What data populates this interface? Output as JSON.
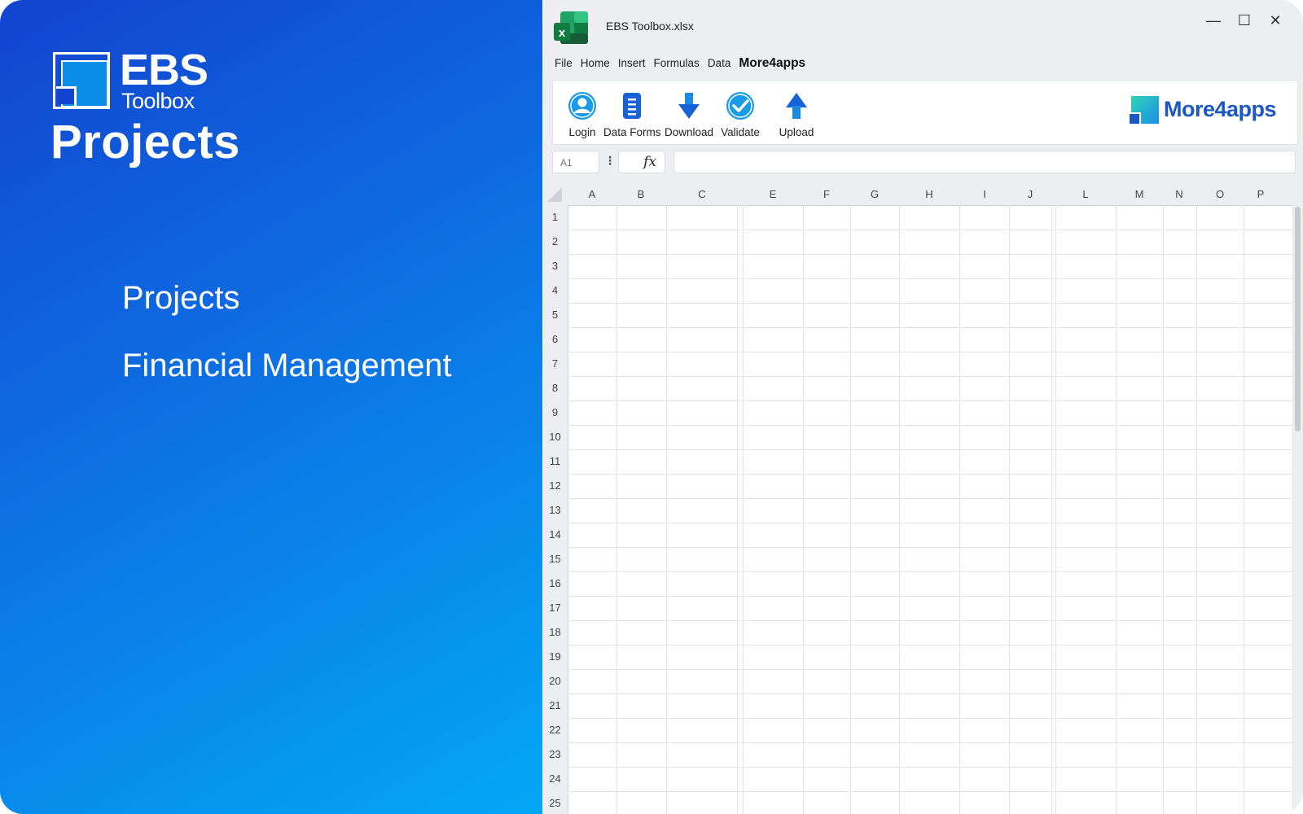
{
  "promo": {
    "brand_name": "EBS",
    "brand_sub": "Toolbox",
    "title": "Projects",
    "features": [
      "Projects",
      "Financial Management"
    ]
  },
  "window": {
    "title": "EBS Toolbox.xlsx",
    "controls": {
      "minimize": "—",
      "maximize": "☐",
      "close": "✕"
    }
  },
  "menu": [
    "File",
    "Home",
    "Insert",
    "Formulas",
    "Data"
  ],
  "menu_active": "More4apps",
  "ribbon": {
    "login": "Login",
    "data_forms": "Data Forms",
    "download": "Download",
    "validate": "Validate",
    "upload": "Upload",
    "brand_logo_text": "More4apps"
  },
  "formula_bar": {
    "name_box": "A1",
    "fx": "fx",
    "value": ""
  },
  "sheet": {
    "columns": [
      "A",
      "B",
      "C",
      "E",
      "F",
      "G",
      "H",
      "I",
      "J",
      "L",
      "M",
      "N",
      "O",
      "P"
    ],
    "rows": [
      "1",
      "2",
      "3",
      "4",
      "5",
      "6",
      "7",
      "8",
      "9",
      "10",
      "11",
      "12",
      "13",
      "14",
      "15",
      "16",
      "17",
      "18",
      "19",
      "20",
      "21",
      "22",
      "23",
      "24",
      "25"
    ]
  },
  "colors": {
    "accent": "#1b58c2",
    "panel_gradient_start": "#1244cf",
    "panel_gradient_end": "#03a8f5",
    "excel_green": "#1d7a45"
  }
}
